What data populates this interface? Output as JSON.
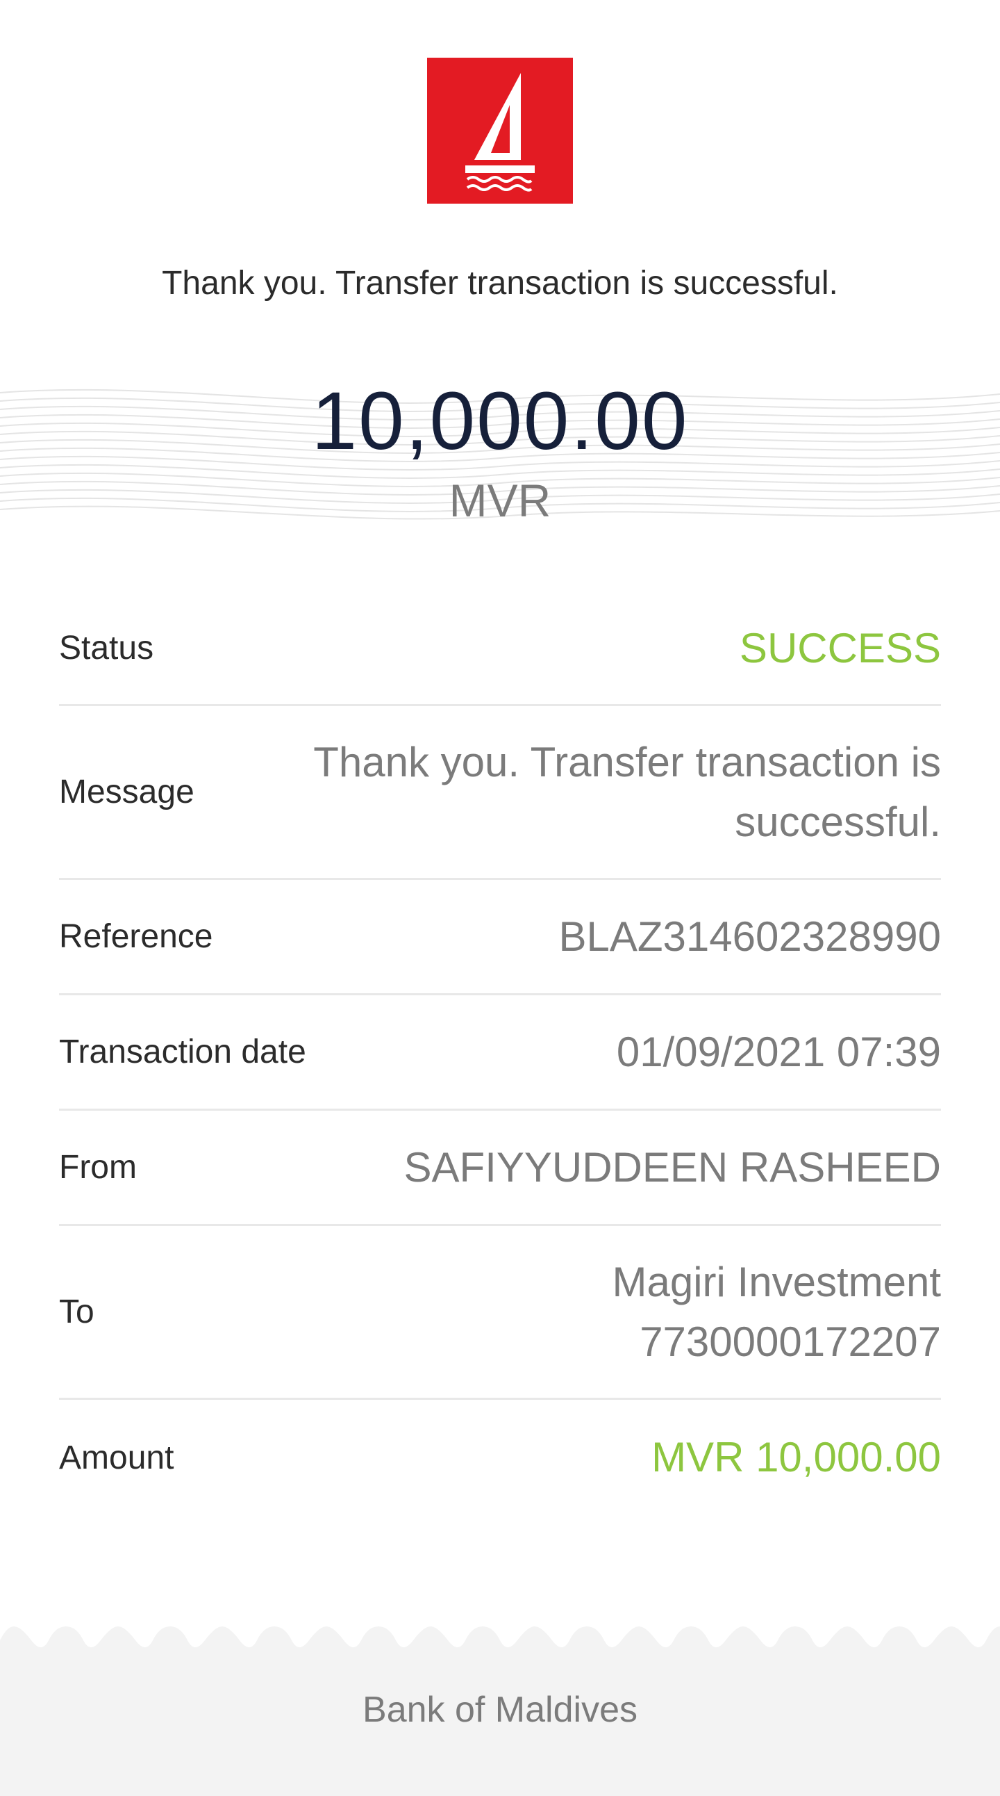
{
  "header": {
    "logo_icon": "bml-sailboat-logo",
    "brand_color": "#e31b23",
    "message": "Thank you. Transfer transaction is successful."
  },
  "amount": {
    "value": "10,000.00",
    "currency": "MVR"
  },
  "details": {
    "status": {
      "label": "Status",
      "value": "SUCCESS"
    },
    "message": {
      "label": "Message",
      "value": "Thank you. Transfer transaction is successful."
    },
    "reference": {
      "label": "Reference",
      "value": "BLAZ314602328990"
    },
    "transaction_date": {
      "label": "Transaction date",
      "value": "01/09/2021 07:39"
    },
    "from": {
      "label": "From",
      "value": "SAFIYYUDDEEN RASHEED"
    },
    "to": {
      "label": "To",
      "name": "Magiri Investment",
      "account": "7730000172207"
    },
    "amount": {
      "label": "Amount",
      "value": "MVR 10,000.00"
    }
  },
  "colors": {
    "success": "#8dc63f",
    "primary_text": "#16203a",
    "secondary_text": "#7b7b7b"
  },
  "footer": {
    "text": "Bank of Maldives"
  }
}
